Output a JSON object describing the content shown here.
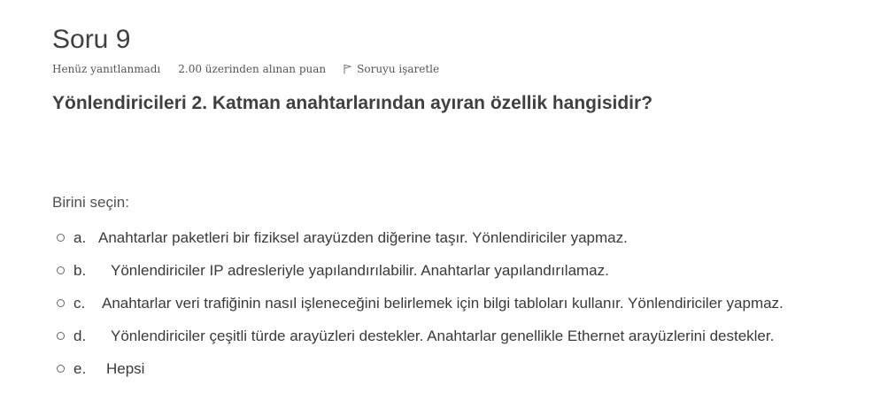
{
  "question": {
    "title": "Soru 9",
    "status": "Henüz yanıtlanmadı",
    "grade": "2.00 üzerinden alınan puan",
    "flag_label": "Soruyu işaretle",
    "text": "Yönlendiricileri 2. Katman anahtarlarından ayıran özellik hangisidir?",
    "prompt": "Birini seçin:",
    "answers": [
      {
        "letter": "a.",
        "text": "Anahtarlar paketleri bir fiziksel arayüzden diğerine taşır. Yönlendiriciler yapmaz."
      },
      {
        "letter": "b.",
        "text": "Yönlendiriciler IP adresleriyle yapılandırılabilir. Anahtarlar yapılandırılamaz."
      },
      {
        "letter": "c.",
        "text": "Anahtarlar veri trafiğinin nasıl işleneceğini belirlemek için bilgi tabloları kullanır. Yönlendiriciler yapmaz."
      },
      {
        "letter": "d.",
        "text": "Yönlendiriciler çeşitli türde arayüzleri destekler. Anahtarlar genellikle Ethernet arayüzlerini destekler."
      },
      {
        "letter": "e.",
        "text": "Hepsi"
      }
    ]
  },
  "icons": {
    "flag": "flag-icon",
    "radio": "radio-button-icon"
  },
  "colors": {
    "text": "#333333",
    "meta": "#555555"
  }
}
